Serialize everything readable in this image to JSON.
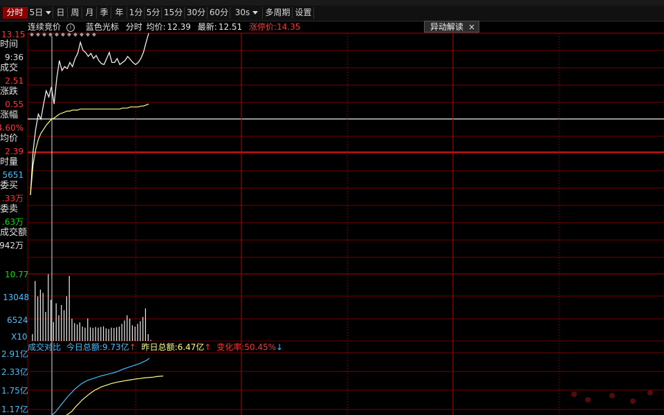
{
  "toolbar": {
    "tabs": [
      {
        "label": "分时",
        "active": true
      },
      {
        "label": "5日",
        "dropdown": true
      },
      {
        "label": "日"
      },
      {
        "label": "周"
      },
      {
        "label": "月"
      },
      {
        "label": "季"
      },
      {
        "label": "年"
      },
      {
        "label": "1分"
      },
      {
        "label": "5分"
      },
      {
        "label": "15分"
      },
      {
        "label": "30分"
      },
      {
        "label": "60分"
      },
      {
        "label": "30s",
        "dropdown": true
      },
      {
        "label": "多周期"
      },
      {
        "label": "设置"
      }
    ]
  },
  "info": {
    "label1": "连续竞价",
    "label2": "蓝色光标",
    "label3": "分时",
    "avg_label": "均价:",
    "avg_value": "12.39",
    "latest_label": "最新:",
    "latest_value": "12.51",
    "limit_up_label": "涨停价:",
    "limit_up_value": "14.35",
    "anomaly_label": "异动解读",
    "close_symbol": "×"
  },
  "left_panel": {
    "top_price": "13.15",
    "time_label": "时间",
    "time_value": "9:36",
    "deal_label": "成交",
    "deal_value": "2.51",
    "change_label": "涨跌",
    "change_value": "0.55",
    "pct_label": "涨幅",
    "pct_value": "4.60%",
    "avg_label": "均价",
    "avg_value": "2.39",
    "vol_label": "时量",
    "vol_value": "5651",
    "bid_label": "委买",
    "bid_value": ".33万",
    "ask_label": "委卖",
    "ask_value": ".63万",
    "amount_label": "成交额",
    "amount_value": "942万",
    "bottom_price": "10.77"
  },
  "volume_axis": {
    "v1": "13048",
    "v2": "6524",
    "unit": "X10"
  },
  "turnover": {
    "title": "成交对比",
    "today_label": "今日总额:",
    "today_value": "9.73亿",
    "yest_label": "昨日总额:",
    "yest_value": "6.47亿",
    "change_label": "变化率:",
    "change_value": "50.45%",
    "axis": [
      "2.91亿",
      "2.33亿",
      "1.75亿",
      "1.17亿"
    ]
  },
  "colors": {
    "up": "#ff3232",
    "down": "#00e000",
    "cyan": "#40c0ff",
    "yellow": "#ffff80",
    "grid": "#7a0000"
  },
  "chart_data": {
    "type": "line",
    "price_range": [
      10.77,
      13.15
    ],
    "reference_price": 11.96,
    "price_series": {
      "name": "",
      "x_minutes": [
        0,
        1,
        2,
        3,
        4,
        5,
        6,
        7,
        8,
        9,
        10,
        11,
        12,
        13,
        14,
        15,
        16,
        17,
        18,
        19,
        20,
        21,
        22,
        23,
        24,
        25,
        26,
        27,
        28,
        29,
        30,
        31,
        32,
        33,
        34,
        35,
        36,
        37,
        38,
        39,
        40,
        41,
        42,
        43,
        44,
        45
      ],
      "values": [
        11.55,
        11.98,
        12.2,
        12.35,
        12.3,
        12.45,
        12.58,
        12.52,
        12.62,
        12.45,
        12.7,
        12.88,
        12.78,
        12.82,
        12.8,
        12.86,
        12.82,
        12.9,
        12.95,
        13.06,
        12.98,
        12.96,
        12.92,
        12.95,
        12.9,
        12.93,
        12.88,
        12.85,
        12.84,
        12.9,
        12.96,
        12.86,
        12.86,
        12.9,
        12.84,
        12.86,
        12.88,
        12.92,
        12.89,
        12.86,
        12.84,
        12.86,
        12.9,
        12.96,
        13.06,
        13.15
      ]
    },
    "avg_series": {
      "name": "",
      "values": [
        11.55,
        11.85,
        12.0,
        12.1,
        12.16,
        12.2,
        12.24,
        12.27,
        12.3,
        12.31,
        12.33,
        12.35,
        12.36,
        12.37,
        12.38,
        12.38,
        12.39,
        12.39,
        12.39,
        12.4,
        12.4,
        12.4,
        12.4,
        12.4,
        12.4,
        12.4,
        12.4,
        12.4,
        12.4,
        12.4,
        12.4,
        12.4,
        12.4,
        12.4,
        12.4,
        12.41,
        12.41,
        12.41,
        12.42,
        12.42,
        12.42,
        12.42,
        12.43,
        12.43,
        12.44,
        12.45
      ]
    },
    "volume_range": [
      0,
      19572
    ],
    "volume_values": [
      2000,
      17500,
      13000,
      15000,
      14000,
      8500,
      19500,
      12000,
      5500,
      11000,
      7500,
      10500,
      9000,
      13048,
      19000,
      6500,
      5200,
      4800,
      5400,
      4200,
      3900,
      6600,
      4000,
      3800,
      4100,
      3900,
      4100,
      4300,
      3700,
      3500,
      3900,
      3800,
      4000,
      4200,
      5000,
      6000,
      7500,
      6524,
      4600,
      4200,
      5000,
      5800,
      7000,
      9500,
      2000,
      300
    ],
    "turnover_range_yi": [
      0.9,
      3.2
    ],
    "today_turnover_yi": [
      0.9,
      1.0,
      1.15,
      1.3,
      1.45,
      1.6,
      1.72,
      1.85,
      1.95,
      2.05,
      2.12,
      2.18,
      2.22,
      2.26,
      2.3,
      2.34,
      2.37,
      2.4,
      2.43,
      2.46,
      2.5,
      2.55,
      2.6,
      2.64,
      2.68,
      2.72,
      2.76,
      2.8,
      2.86,
      2.91,
      3.0
    ],
    "yest_turnover_yi": [
      0.88,
      0.95,
      1.05,
      1.2,
      1.32,
      1.45,
      1.55,
      1.65,
      1.74,
      1.82,
      1.88,
      1.94,
      1.98,
      2.02,
      2.06,
      2.09,
      2.12,
      2.14,
      2.16,
      2.18,
      2.2,
      2.22,
      2.24,
      2.25,
      2.27,
      2.28,
      2.29,
      2.3,
      2.32,
      2.33,
      2.34
    ]
  }
}
